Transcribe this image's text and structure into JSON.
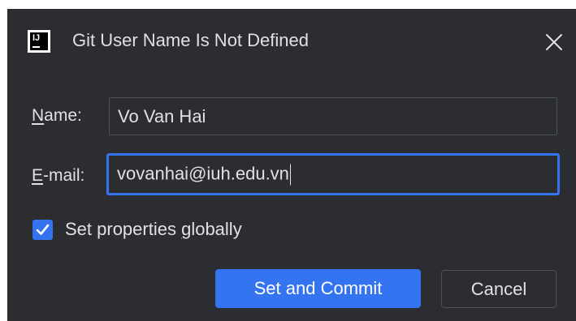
{
  "dialog": {
    "title": "Git User Name Is Not Defined",
    "app_icon": "intellij-icon",
    "app_icon_text": "IJ",
    "close_icon": "close-icon"
  },
  "form": {
    "name_label_mnemonic": "N",
    "name_label_rest": "ame:",
    "name_value": "Vo Van Hai",
    "email_label_mnemonic": "E",
    "email_label_rest": "-mail:",
    "email_value": "vovanhai@iuh.edu.vn",
    "set_globally_before": "Set properties ",
    "set_globally_mnemonic": "g",
    "set_globally_after": "lobally",
    "set_globally_checked": true
  },
  "buttons": {
    "primary_label": "Set and Commit",
    "cancel_label": "Cancel"
  },
  "colors": {
    "background": "#2b2d30",
    "text": "#dfe1e5",
    "accent": "#3574f0",
    "border": "#4e5157"
  }
}
